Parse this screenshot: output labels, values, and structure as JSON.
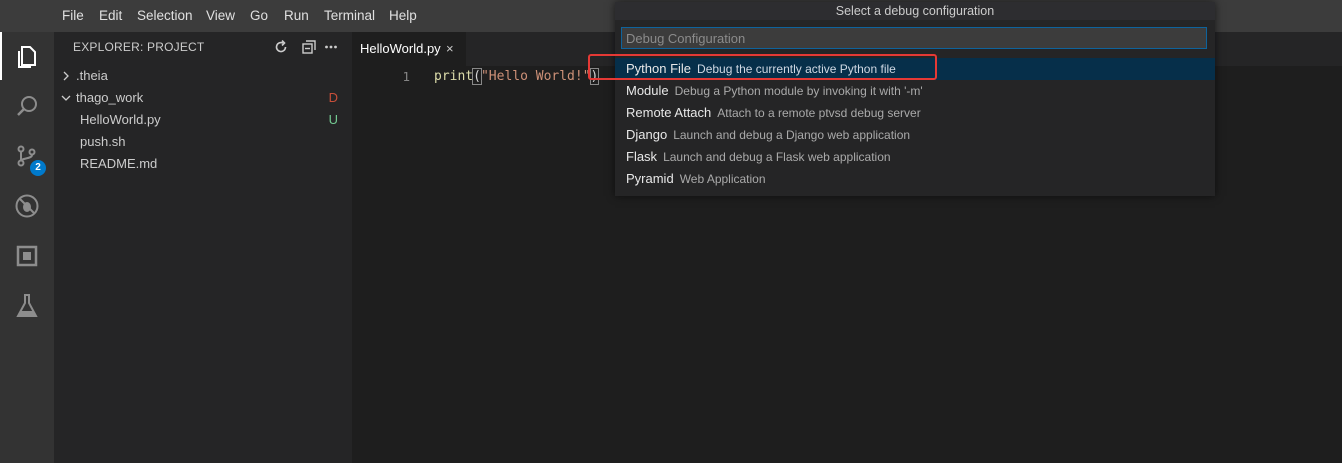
{
  "menu": [
    "File",
    "Edit",
    "Selection",
    "View",
    "Go",
    "Run",
    "Terminal",
    "Help"
  ],
  "activity": {
    "scm_badge": "2",
    "icons": [
      "files-icon",
      "search-icon",
      "source-control-icon",
      "debug-icon",
      "extensions-icon",
      "test-flask-icon"
    ]
  },
  "explorer": {
    "title": "EXPLORER: PROJECT",
    "tree": [
      {
        "label": ".theia",
        "type": "folder",
        "expanded": false,
        "decoration": ""
      },
      {
        "label": "thago_work",
        "type": "folder",
        "expanded": true,
        "decoration": "D"
      },
      {
        "label": "HelloWorld.py",
        "type": "file",
        "decoration": "U"
      },
      {
        "label": "push.sh",
        "type": "file",
        "decoration": ""
      },
      {
        "label": "README.md",
        "type": "file",
        "decoration": ""
      }
    ]
  },
  "editor": {
    "tab": {
      "label": "HelloWorld.py",
      "close": "×"
    },
    "line_number": "1",
    "code": {
      "fn": "print",
      "open": "(",
      "str": "\"Hello World!\"",
      "close": ")"
    }
  },
  "quickpick": {
    "title": "Select a debug configuration",
    "placeholder": "Debug Configuration",
    "items": [
      {
        "name": "Python File",
        "desc": "Debug the currently active Python file",
        "selected": true
      },
      {
        "name": "Module",
        "desc": "Debug a Python module by invoking it with '-m'"
      },
      {
        "name": "Remote Attach",
        "desc": "Attach to a remote ptvsd debug server"
      },
      {
        "name": "Django",
        "desc": "Launch and debug a Django web application"
      },
      {
        "name": "Flask",
        "desc": "Launch and debug a Flask web application"
      },
      {
        "name": "Pyramid",
        "desc": "Web Application"
      }
    ]
  },
  "colors": {
    "accent": "#007acc",
    "highlight": "#e53935",
    "decoration_deleted": "#c74e39",
    "decoration_untracked": "#73c991"
  }
}
